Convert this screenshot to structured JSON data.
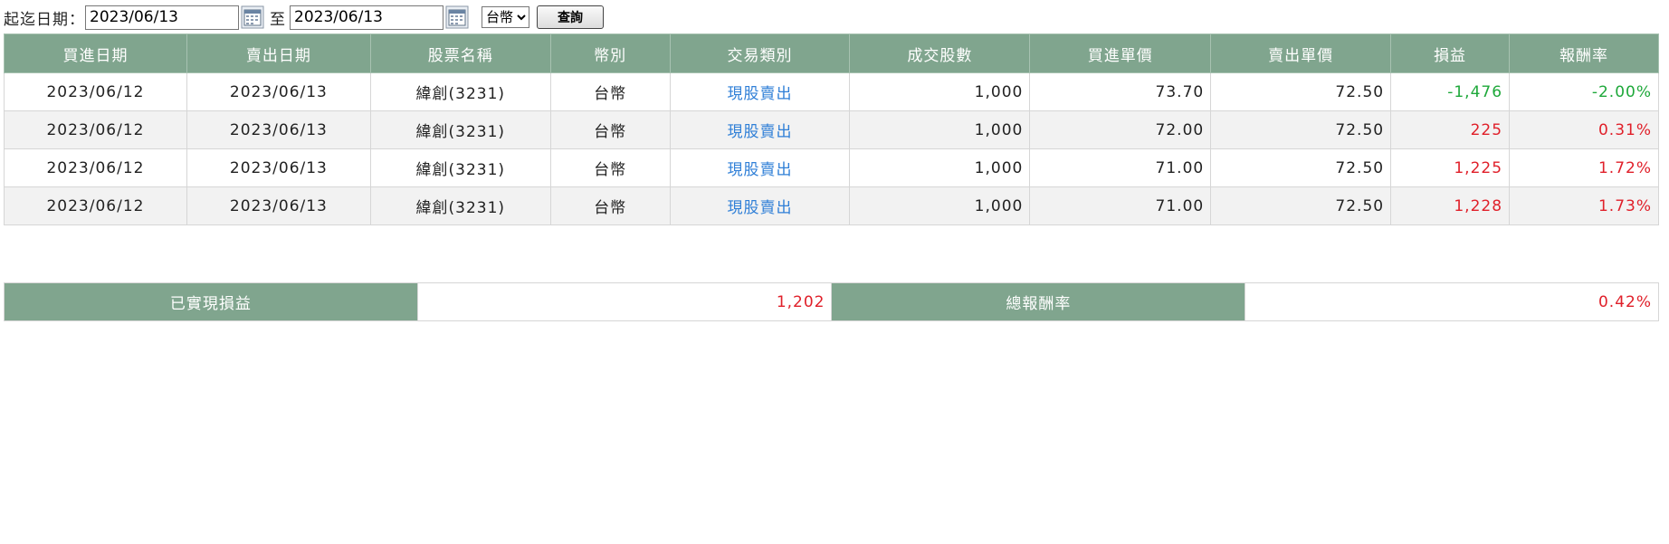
{
  "filter": {
    "date_label": "起迄日期：",
    "start_date": "2023/06/13",
    "to_label": "至",
    "end_date": "2023/06/13",
    "currency_selected": "台幣",
    "query_label": "查詢"
  },
  "table": {
    "headers": [
      "買進日期",
      "賣出日期",
      "股票名稱",
      "幣別",
      "交易類別",
      "成交股數",
      "買進單價",
      "賣出單價",
      "損益",
      "報酬率"
    ],
    "rows": [
      {
        "buy_date": "2023/06/12",
        "sell_date": "2023/06/13",
        "stock": "緯創(3231)",
        "currency": "台幣",
        "type": "現股賣出",
        "shares": "1,000",
        "buy_price": "73.70",
        "sell_price": "72.50",
        "pnl": "-1,476",
        "roi": "-2.00%"
      },
      {
        "buy_date": "2023/06/12",
        "sell_date": "2023/06/13",
        "stock": "緯創(3231)",
        "currency": "台幣",
        "type": "現股賣出",
        "shares": "1,000",
        "buy_price": "72.00",
        "sell_price": "72.50",
        "pnl": "225",
        "roi": "0.31%"
      },
      {
        "buy_date": "2023/06/12",
        "sell_date": "2023/06/13",
        "stock": "緯創(3231)",
        "currency": "台幣",
        "type": "現股賣出",
        "shares": "1,000",
        "buy_price": "71.00",
        "sell_price": "72.50",
        "pnl": "1,225",
        "roi": "1.72%"
      },
      {
        "buy_date": "2023/06/12",
        "sell_date": "2023/06/13",
        "stock": "緯創(3231)",
        "currency": "台幣",
        "type": "現股賣出",
        "shares": "1,000",
        "buy_price": "71.00",
        "sell_price": "72.50",
        "pnl": "1,228",
        "roi": "1.73%"
      }
    ]
  },
  "summary": {
    "realized_label": "已實現損益",
    "realized_value": "1,202",
    "total_roi_label": "總報酬率",
    "total_roi_value": "0.42%"
  },
  "colors": {
    "header_bg": "#80a58e",
    "positive": "#e0202a",
    "negative": "#1ea83a",
    "link": "#2f7fd7",
    "alt_row": "#f2f2f2"
  },
  "icons": {
    "calendar": "calendar-icon"
  }
}
